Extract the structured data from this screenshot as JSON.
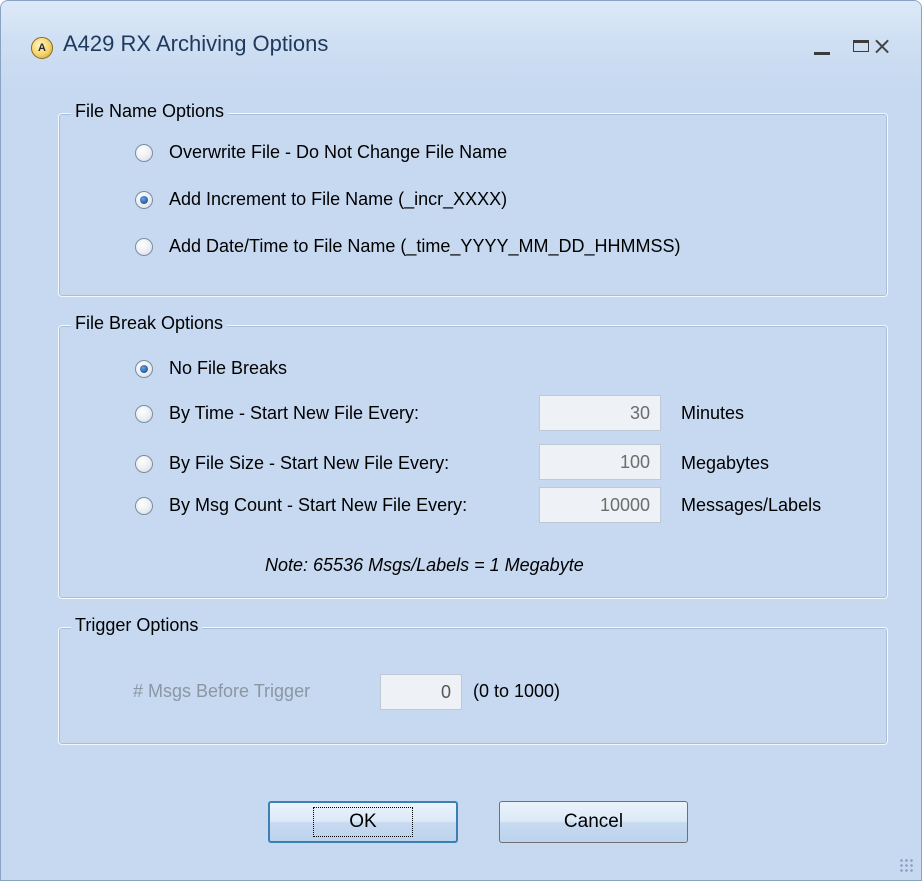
{
  "window": {
    "title": "A429 RX Archiving Options",
    "icon_text": "A",
    "controls": {
      "minimize": "minimize-icon",
      "maximize": "maximize-icon",
      "close": "×"
    }
  },
  "file_name_options": {
    "label": "File Name Options",
    "options": [
      {
        "label": "Overwrite File - Do Not Change File Name",
        "checked": false
      },
      {
        "label": "Add Increment to File Name (_incr_XXXX)",
        "checked": true
      },
      {
        "label": "Add Date/Time to File Name (_time_YYYY_MM_DD_HHMMSS)",
        "checked": false
      }
    ]
  },
  "file_break_options": {
    "label": "File Break Options",
    "options": [
      {
        "label": "No File Breaks",
        "checked": true
      },
      {
        "label": "By Time - Start New File Every:",
        "checked": false,
        "value": "30",
        "unit": "Minutes"
      },
      {
        "label": "By File Size - Start New File Every:",
        "checked": false,
        "value": "100",
        "unit": "Megabytes"
      },
      {
        "label": "By Msg Count - Start New File Every:",
        "checked": false,
        "value": "10000",
        "unit": "Messages/Labels"
      }
    ],
    "note": "Note:  65536 Msgs/Labels = 1 Megabyte"
  },
  "trigger_options": {
    "label": "Trigger Options",
    "field_label": "# Msgs Before Trigger",
    "value": "0",
    "range": "(0 to 1000)"
  },
  "buttons": {
    "ok": "OK",
    "cancel": "Cancel"
  },
  "colors": {
    "background": "#c6d9f1",
    "title_text": "#1e395b",
    "disabled_text": "#8c96a3"
  }
}
